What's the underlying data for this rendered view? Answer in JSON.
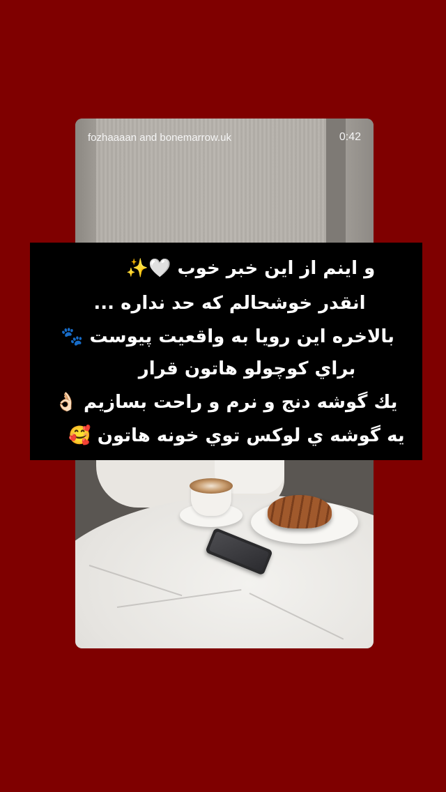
{
  "story": {
    "usernames": "fozhaaaan and bonemarrow.uk",
    "timer": "0:42"
  },
  "caption": {
    "lines": [
      "و اینم از این خبر خوب 🤍✨",
      "انقدر خوشحالم که حد نداره ...",
      "بالاخره این رویا به واقعیت پیوست 🐾",
      "براي كوچولو هاتون قرار",
      "يك گوشه دنج و نرم و راحت بسازيم 👌🏻",
      "يه گوشه ي لوكس توي خونه هاتون 🥰"
    ]
  },
  "colors": {
    "background": "#7f0000",
    "caption_box": "#000000",
    "caption_text": "#ffffff",
    "header_text": "#f5f5f5"
  }
}
